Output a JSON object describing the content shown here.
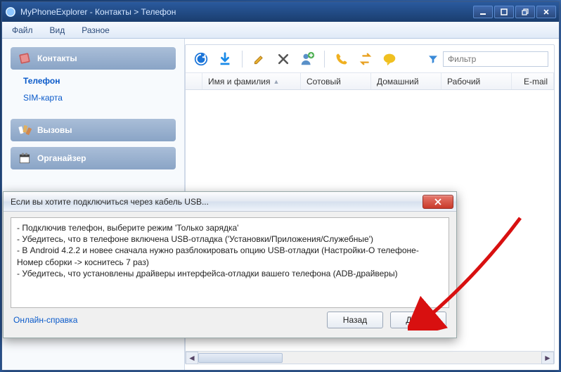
{
  "window": {
    "title": "MyPhoneExplorer -   Контакты > Телефон"
  },
  "menu": {
    "file": "Файл",
    "view": "Вид",
    "misc": "Разное"
  },
  "sidebar": {
    "contacts": {
      "label": "Контакты"
    },
    "phone": {
      "label": "Телефон"
    },
    "sim": {
      "label": "SIM-карта"
    },
    "calls": {
      "label": "Вызовы"
    },
    "organizer": {
      "label": "Органайзер"
    }
  },
  "toolbar": {
    "filter_placeholder": "Фильтр"
  },
  "columns": {
    "name": "Имя и фамилия",
    "mobile": "Сотовый",
    "home": "Домашний",
    "work": "Рабочий",
    "email": "E-mail"
  },
  "dialog": {
    "title": "Если вы хотите подключиться через кабель USB...",
    "line1": "- Подключив телефон, выберите режим 'Только зарядка'",
    "line2": "- Убедитесь, что в телефоне включена USB-отладка ('Установки/Приложения/Служебные')",
    "line3": "- В Android 4.2.2 и новее сначала нужно разблокировать опцию USB-отладки (Настройки-О телефоне-Номер сборки -> коснитесь 7 раз)",
    "line4": "- Убедитесь, что установлены драйверы интерфейса-отладки вашего телефона (ADB-драйверы)",
    "help_link": "Онлайн-справка",
    "back": "Назад",
    "next": "Далее"
  }
}
